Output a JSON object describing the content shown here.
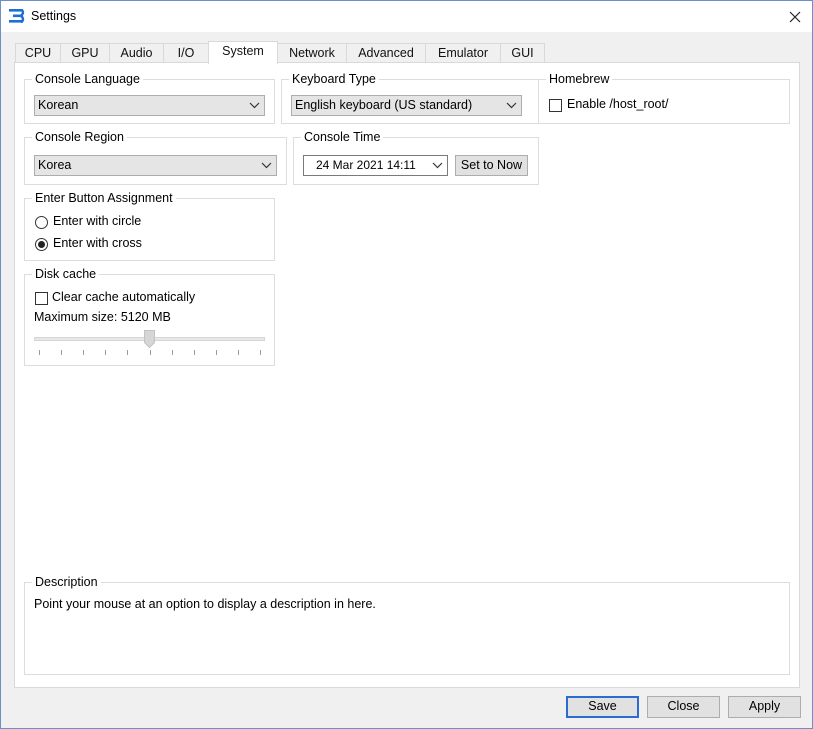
{
  "window": {
    "title": "Settings"
  },
  "tabs": [
    "CPU",
    "GPU",
    "Audio",
    "I/O",
    "System",
    "Network",
    "Advanced",
    "Emulator",
    "GUI"
  ],
  "active_tab": "System",
  "console_language": {
    "title": "Console Language",
    "value": "Korean"
  },
  "keyboard_type": {
    "title": "Keyboard Type",
    "value": "English keyboard (US standard)"
  },
  "homebrew": {
    "title": "Homebrew",
    "checkbox_label": "Enable /host_root/",
    "checked": false
  },
  "console_region": {
    "title": "Console Region",
    "value": "Korea"
  },
  "console_time": {
    "title": "Console Time",
    "value": "24 Mar 2021 14:11",
    "set_now_label": "Set to Now"
  },
  "enter_button": {
    "title": "Enter Button Assignment",
    "options": [
      "Enter with circle",
      "Enter with cross"
    ],
    "selected": "Enter with cross"
  },
  "disk_cache": {
    "title": "Disk cache",
    "clear_label": "Clear cache automatically",
    "clear_checked": false,
    "max_size_label": "Maximum size: 5120 MB",
    "slider_fraction": 0.5
  },
  "description": {
    "title": "Description",
    "text": "Point your mouse at an option to display a description in here."
  },
  "footer": {
    "save_label": "Save",
    "close_label": "Close",
    "apply_label": "Apply"
  },
  "colors": {
    "accent": "#2e6bd1",
    "window_bg": "#f0f0f0",
    "panel_bg": "#ffffff"
  }
}
